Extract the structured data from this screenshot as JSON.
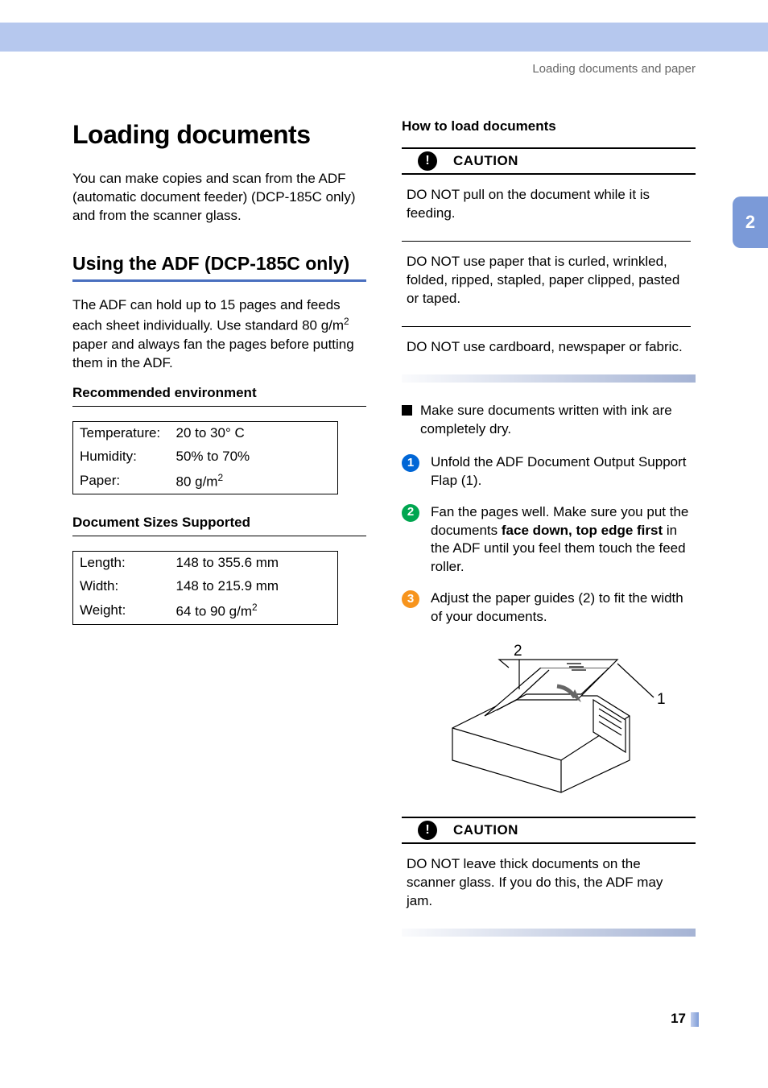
{
  "running_head": "Loading documents and paper",
  "side_tab": "2",
  "page_number": "17",
  "left": {
    "h1": "Loading documents",
    "intro": "You can make copies and scan from the ADF (automatic document feeder) (DCP-185C only) and from the scanner glass.",
    "h2": "Using the ADF (DCP-185C only)",
    "adf_para_pre": "The ADF can hold up to 15 pages and feeds each sheet individually. Use standard 80 g/m",
    "adf_para_sup": "2",
    "adf_para_post": " paper and always fan the pages before putting them in the ADF.",
    "env_heading": "Recommended environment",
    "env": {
      "r1label": "Temperature:",
      "r1val": "20 to 30° C",
      "r2label": "Humidity:",
      "r2val": "50% to 70%",
      "r3label": "Paper:",
      "r3val_pre": "80 g/m",
      "r3val_sup": "2"
    },
    "sizes_heading": "Document Sizes Supported",
    "sizes": {
      "r1label": "Length:",
      "r1val": "148 to 355.6 mm",
      "r2label": "Width:",
      "r2val": "148 to 215.9 mm",
      "r3label": "Weight:",
      "r3val_pre": "64 to 90 g/m",
      "r3val_sup": "2"
    }
  },
  "right": {
    "h3": "How to load documents",
    "caution_label": "CAUTION",
    "caution1_item1": "DO NOT pull on the document while it is feeding.",
    "caution1_item2": "DO NOT use paper that is curled, wrinkled, folded, ripped, stapled, paper clipped, pasted or taped.",
    "caution1_item3": "DO NOT use cardboard, newspaper or fabric.",
    "bullet1": "Make sure documents written with ink are completely dry.",
    "step1": "Unfold the ADF Document Output Support Flap (1).",
    "step2_pre": "Fan the pages well. Make sure you put the documents ",
    "step2_bold": "face down, top edge first",
    "step2_post": " in the ADF until you feel them touch the feed roller.",
    "step3": "Adjust the paper guides (2) to fit the width of your documents.",
    "illus_label2": "2",
    "illus_label1": "1",
    "caution2_text": "DO NOT leave thick documents on the scanner glass. If you do this, the ADF may jam."
  }
}
